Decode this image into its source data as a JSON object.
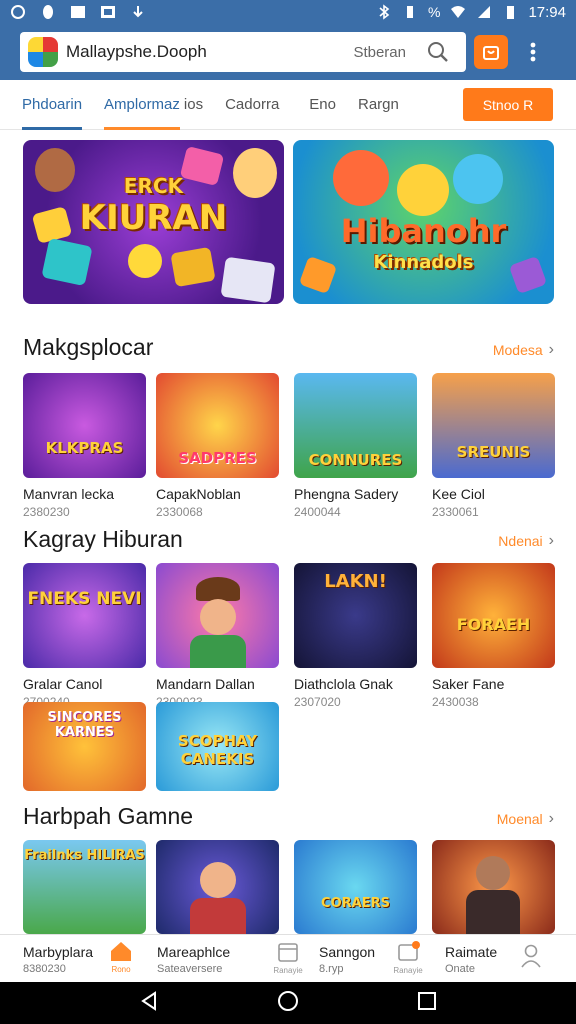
{
  "status_bar": {
    "time": "17:94",
    "battery_percent_text": "%"
  },
  "app_bar": {
    "site_title": "Mallaypshe.Dooph",
    "search_label": "Stberan"
  },
  "tabs": [
    {
      "label": "Phdoarin"
    },
    {
      "label": "Amplormaz"
    },
    {
      "label": "ios"
    },
    {
      "label": "Cadorra"
    },
    {
      "label": "Eno"
    },
    {
      "label": "Rargn"
    }
  ],
  "promo_button": "Stnoo R",
  "banners": [
    {
      "line1": "ERCK",
      "line2": "KIURAN"
    },
    {
      "line1": "Hibanohr",
      "line2": "Kinnadols"
    }
  ],
  "sections": [
    {
      "title": "Makgsplocar",
      "more": "Modesa",
      "games": [
        {
          "thumb": "KLKPRAS",
          "title": "Manvran lecka",
          "sub": "2380230"
        },
        {
          "thumb": "SADPRES",
          "title": "CapakNoblan",
          "sub": "2330068"
        },
        {
          "thumb": "CONNURES",
          "title": "Phengna Sadery",
          "sub": "2400044"
        },
        {
          "thumb": "SREUNIS",
          "title": "Kee Ciol",
          "sub": "2330061"
        }
      ]
    },
    {
      "title": "Kagray Hiburan",
      "more": "Ndenai",
      "games": [
        {
          "thumb": "FNEKS NEVI",
          "title": "Gralar Canol",
          "sub": "2700240"
        },
        {
          "thumb": "",
          "title": "Mandarn Dallan",
          "sub": "2300023"
        },
        {
          "thumb": "LAKN!",
          "title": "Diathclola Gnak",
          "sub": "2307020"
        },
        {
          "thumb": "FORAEH",
          "title": "Saker Fane",
          "sub": "2430038"
        },
        {
          "thumb": "SINCORES KARNES",
          "title": "",
          "sub": ""
        },
        {
          "thumb": "SCOPHAY CANEKIS",
          "title": "",
          "sub": ""
        }
      ]
    },
    {
      "title": "Harbpah Gamne",
      "more": "Moenal",
      "games": [
        {
          "thumb": "Frailnks HILIRAS",
          "title": "",
          "sub": ""
        },
        {
          "thumb": "",
          "title": "",
          "sub": ""
        },
        {
          "thumb": "CORAERS",
          "title": "",
          "sub": ""
        },
        {
          "thumb": "",
          "title": "",
          "sub": ""
        }
      ]
    }
  ],
  "bottom_nav": {
    "left_title": "Marbyplara",
    "left_sub": "8380230",
    "home_label": "Rono",
    "mid_title": "Mareaphlce",
    "mid_sub": "Sateaversere",
    "news_label": "Ranayie",
    "seancon_title": "Sanngon",
    "seancon_sub": "8.ryp",
    "msg_label": "Ranayie",
    "right_title": "Raimate",
    "right_sub": "Onate"
  }
}
